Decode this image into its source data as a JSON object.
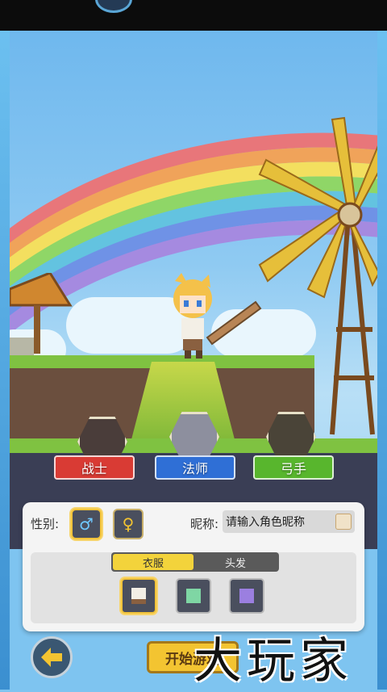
{
  "classes": [
    {
      "id": "warrior",
      "label": "战士",
      "ribbon_color": "#d93b34",
      "icon": "crossed-swords-icon"
    },
    {
      "id": "mage",
      "label": "法师",
      "ribbon_color": "#2f6fd6",
      "icon": "winged-staff-icon"
    },
    {
      "id": "archer",
      "label": "弓手",
      "ribbon_color": "#58b62d",
      "icon": "crossbow-icon"
    }
  ],
  "gender": {
    "label": "性别:",
    "male_icon": "male-symbol-icon",
    "female_icon": "female-symbol-icon",
    "selected": "male"
  },
  "nickname": {
    "label": "昵称:",
    "placeholder": "请输入角色昵称",
    "random_icon": "dice-icon"
  },
  "tabs": [
    {
      "label": "衣服",
      "selected": true
    },
    {
      "label": "头发",
      "selected": false
    }
  ],
  "outfits": [
    {
      "icon": "white-shirt-icon",
      "color": "#f3efe6",
      "selected": true
    },
    {
      "icon": "green-shirt-icon",
      "color": "#7fd6a4",
      "selected": false
    },
    {
      "icon": "purple-shirt-icon",
      "color": "#9b7fe0",
      "selected": false
    }
  ],
  "buttons": {
    "back_icon": "back-arrow-icon",
    "start": "开始游戏"
  },
  "watermark": "大玩家"
}
